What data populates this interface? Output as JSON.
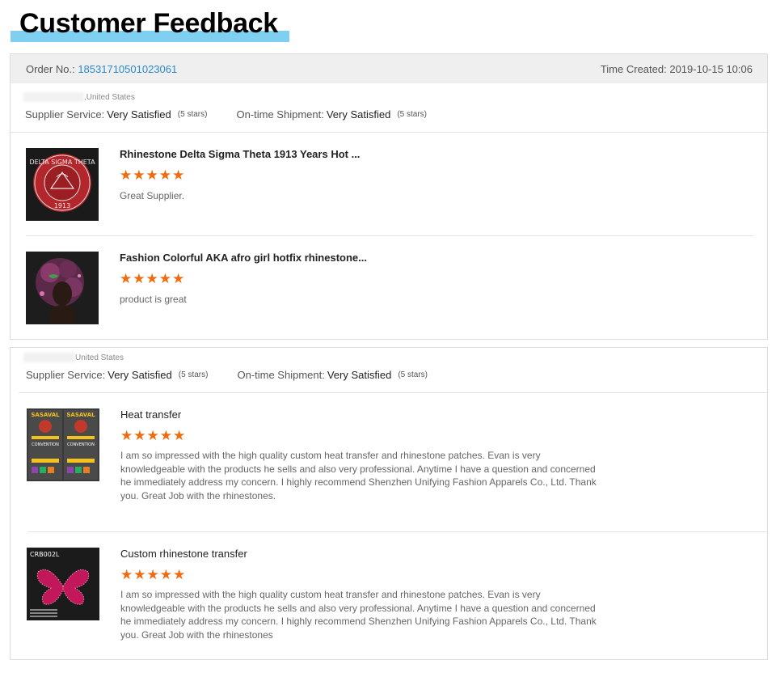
{
  "page_title": "Customer Feedback",
  "order": {
    "order_no_label": "Order No.:",
    "order_no": "18531710501023061",
    "time_label": "Time Created:",
    "time_value": "2019-10-15 10:06"
  },
  "feedbacks": [
    {
      "buyer_country": ",United States",
      "supplier_service_label": "Supplier Service:",
      "supplier_service_value": "Very Satisfied",
      "supplier_service_stars": "(5 stars)",
      "shipment_label": "On-time Shipment:",
      "shipment_value": "Very Satisfied",
      "shipment_stars": "(5 stars)",
      "items": [
        {
          "title": "Rhinestone Delta Sigma Theta 1913 Years Hot ...",
          "stars": "★★★★★",
          "rating": 5,
          "comment": "Great Supplier."
        },
        {
          "title": "Fashion Colorful AKA afro girl hotfix rhinestone...",
          "stars": "★★★★★",
          "rating": 5,
          "comment": "product is great"
        }
      ]
    },
    {
      "buyer_country": "United States",
      "supplier_service_label": "Supplier Service:",
      "supplier_service_value": "Very Satisfied",
      "supplier_service_stars": "(5 stars)",
      "shipment_label": "On-time Shipment:",
      "shipment_value": "Very Satisfied",
      "shipment_stars": "(5 stars)",
      "items": [
        {
          "title": "Heat transfer",
          "stars": "★★★★★",
          "rating": 5,
          "comment": "I am so impressed with the high quality custom heat transfer and rhinestone patches. Evan is very knowledgeable with the products he sells and also very professional. Anytime I have a question and concerned he immediately address my concern. I highly recommend Shenzhen Unifying Fashion Apparels Co., Ltd.  Thank you. Great Job with the rhinestones."
        },
        {
          "title": "Custom rhinestone transfer",
          "stars": "★★★★★",
          "rating": 5,
          "comment": "I am so impressed with the high quality custom heat transfer and rhinestone patches. Evan is very knowledgeable with the products he sells and also very professional. Anytime I have a question and concerned he immediately address my concern. I highly recommend Shenzhen Unifying Fashion Apparels Co., Ltd.  Thank you. Great Job with the rhinestones"
        }
      ]
    }
  ],
  "thumbnails": {
    "delta": {
      "ring_text": "DELTA SIGMA THETA",
      "year": "1913"
    },
    "heat": {
      "brand": "SASAVAL",
      "line": "CONVENTION"
    },
    "custom": {
      "code": "CRB002L"
    }
  },
  "colors": {
    "star": "#f06a0f",
    "order_no": "#2b8ac8",
    "title_underline": "#7fd0f0",
    "header_bg": "#efefef"
  }
}
